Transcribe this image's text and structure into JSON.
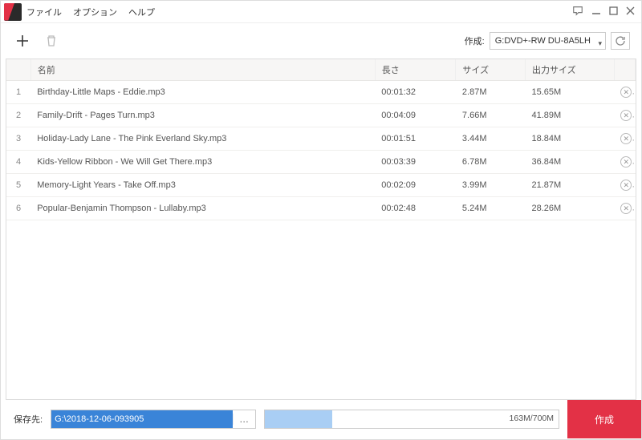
{
  "menu": {
    "file": "ファイル",
    "option": "オプション",
    "help": "ヘルプ"
  },
  "toolbar": {
    "create_label": "作成:",
    "drive": "G:DVD+-RW DU-8A5LH"
  },
  "columns": {
    "name": "名前",
    "length": "長さ",
    "size": "サイズ",
    "output": "出力サイズ"
  },
  "rows": [
    {
      "idx": "1",
      "name": "Birthday-Little Maps - Eddie.mp3",
      "length": "00:01:32",
      "size": "2.87M",
      "output": "15.65M"
    },
    {
      "idx": "2",
      "name": "Family-Drift - Pages Turn.mp3",
      "length": "00:04:09",
      "size": "7.66M",
      "output": "41.89M"
    },
    {
      "idx": "3",
      "name": "Holiday-Lady Lane - The Pink Everland Sky.mp3",
      "length": "00:01:51",
      "size": "3.44M",
      "output": "18.84M"
    },
    {
      "idx": "4",
      "name": "Kids-Yellow Ribbon - We Will Get There.mp3",
      "length": "00:03:39",
      "size": "6.78M",
      "output": "36.84M"
    },
    {
      "idx": "5",
      "name": "Memory-Light Years - Take Off.mp3",
      "length": "00:02:09",
      "size": "3.99M",
      "output": "21.87M"
    },
    {
      "idx": "6",
      "name": "Popular-Benjamin Thompson - Lullaby.mp3",
      "length": "00:02:48",
      "size": "5.24M",
      "output": "28.26M"
    }
  ],
  "footer": {
    "save_label": "保存先:",
    "path": "G:\\2018-12-06-093905",
    "progress_text": "163M/700M",
    "create_button": "作成"
  }
}
